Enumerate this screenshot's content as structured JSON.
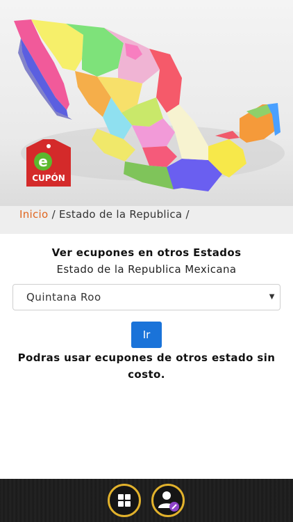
{
  "hero": {
    "image": "mexico-3d-map",
    "logo_letter": "e",
    "logo_text": "CUPÓN",
    "colors": {
      "logo_red": "#d42a2a",
      "logo_green": "#5cb82e"
    }
  },
  "breadcrumb": {
    "home": "Inicio",
    "separator": "/",
    "current": "Estado de la Republica"
  },
  "main": {
    "heading": "Ver ecupones en otros Estados",
    "subheading": "Estado de la Republica Mexicana",
    "state_select": {
      "value": "Quintana Roo",
      "caret": "▼"
    },
    "go_button": "Ir",
    "note": "Podras usar ecupones de otros estado sin costo."
  },
  "bottom_nav": {
    "items": [
      {
        "icon": "grid-icon"
      },
      {
        "icon": "user-edit-icon"
      }
    ],
    "accent": "#e2b22c"
  }
}
